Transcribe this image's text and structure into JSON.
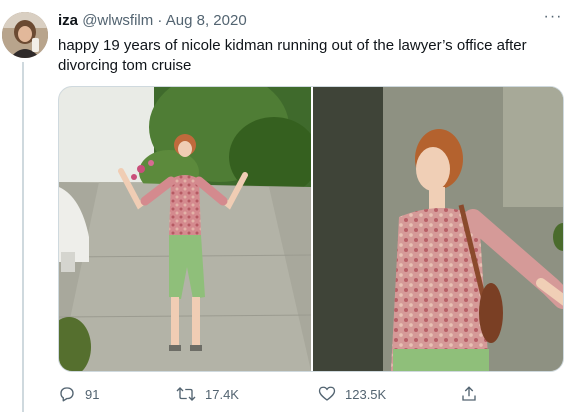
{
  "tweet": {
    "author_name": "iza",
    "author_handle": "@wlwsfilm",
    "separator": " · ",
    "date": "Aug 8, 2020",
    "more_label": "···",
    "text": "happy 19 years of nicole kidman running out of the lawyer’s office after divorcing tom cruise",
    "media": [
      {
        "icon": "photo-woman-running-outdoors"
      },
      {
        "icon": "photo-woman-arms-outstretched-closeup"
      }
    ],
    "actions": {
      "reply": {
        "icon": "reply-icon",
        "count": "91"
      },
      "retweet": {
        "icon": "retweet-icon",
        "count": "17.4K"
      },
      "like": {
        "icon": "like-icon",
        "count": "123.5K"
      },
      "share": {
        "icon": "share-icon"
      }
    }
  },
  "colors": {
    "text_primary": "#0f1419",
    "text_secondary": "#536471",
    "border": "#cfd9de"
  }
}
